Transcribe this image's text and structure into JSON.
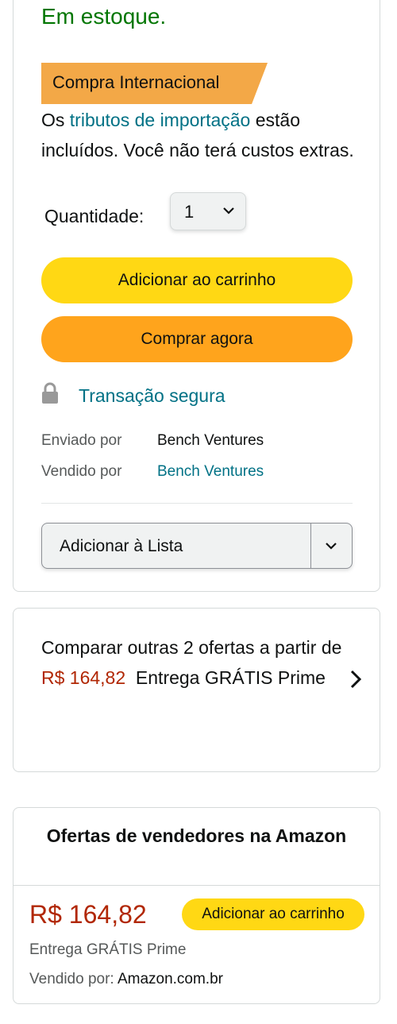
{
  "buybox": {
    "stock": "Em estoque.",
    "badge": "Compra Internacional",
    "tributos_prefix": "Os ",
    "tributos_link": "tributos de importação",
    "tributos_suffix": " estão incluídos. Você não terá custos extras.",
    "quantity_label": "Quantidade:",
    "quantity_value": "1",
    "add_to_cart": "Adicionar ao carrinho",
    "buy_now": "Comprar agora",
    "secure_transaction": "Transação segura",
    "shipped_by_label": "Enviado por",
    "shipped_by_value": "Bench Ventures",
    "sold_by_label": "Vendido por",
    "sold_by_value": "Bench Ventures",
    "add_to_list": "Adicionar à Lista"
  },
  "compare": {
    "text_line": "Comparar outras 2 ofertas a partir de",
    "price": "R$ 164,82",
    "delivery": "Entrega GRÁTIS Prime"
  },
  "offers": {
    "title": "Ofertas de vendedores na Amazon",
    "price": "R$ 164,82",
    "add_to_cart": "Adicionar ao carrinho",
    "delivery": "Entrega GRÁTIS Prime",
    "sold_by_label": "Vendido por:",
    "sold_by_value": "Amazon.com.br"
  },
  "icons": {
    "lock": "lock-icon",
    "dropdown": "chevron-down-icon",
    "next": "chevron-right-icon"
  },
  "colors": {
    "stock_green": "#007600",
    "link_teal": "#007185",
    "price_red": "#b12704",
    "cart_yellow": "#ffd814",
    "buy_orange": "#ffa41c",
    "badge_orange": "#f3a847"
  }
}
